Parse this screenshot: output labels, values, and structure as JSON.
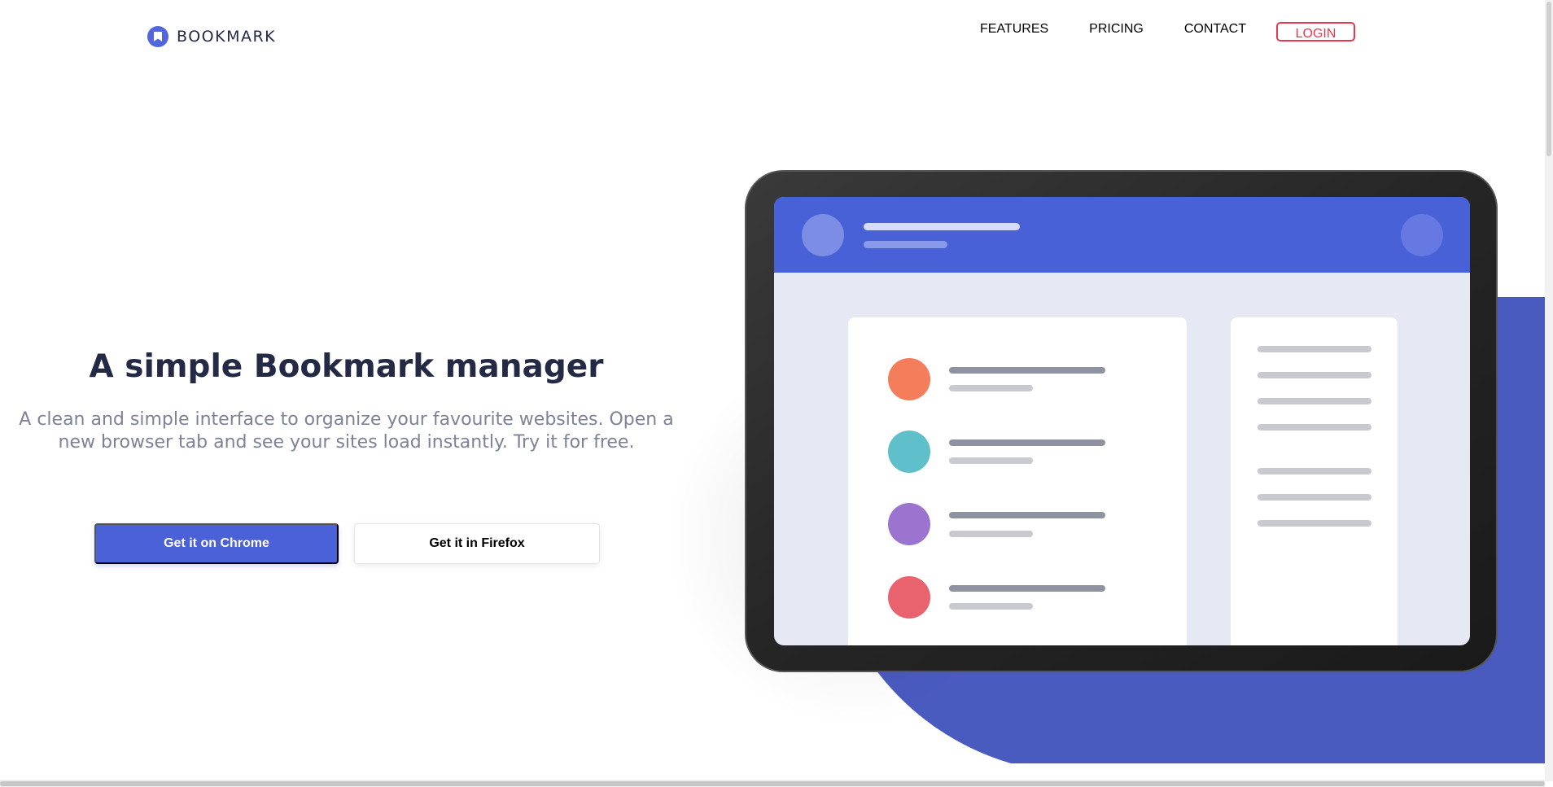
{
  "brand": {
    "name": "BOOKMARK",
    "accent": "#5267DF",
    "red": "#E63950",
    "dark": "#242A45"
  },
  "nav": {
    "items": [
      {
        "label": "FEATURES"
      },
      {
        "label": "PRICING"
      },
      {
        "label": "CONTACT"
      }
    ],
    "login_label": "LOGIN"
  },
  "hero": {
    "title": "A simple Bookmark manager",
    "description": "A clean and simple interface to organize your favourite websites. Open a new browser tab and see your sites load instantly. Try it for free.",
    "chrome_label": "Get it on Chrome",
    "firefox_label": "Get it in Firefox"
  },
  "illustration": {
    "item_colors": [
      "#F47E5B",
      "#5FC0CB",
      "#9B74CF",
      "#E9636F"
    ]
  }
}
